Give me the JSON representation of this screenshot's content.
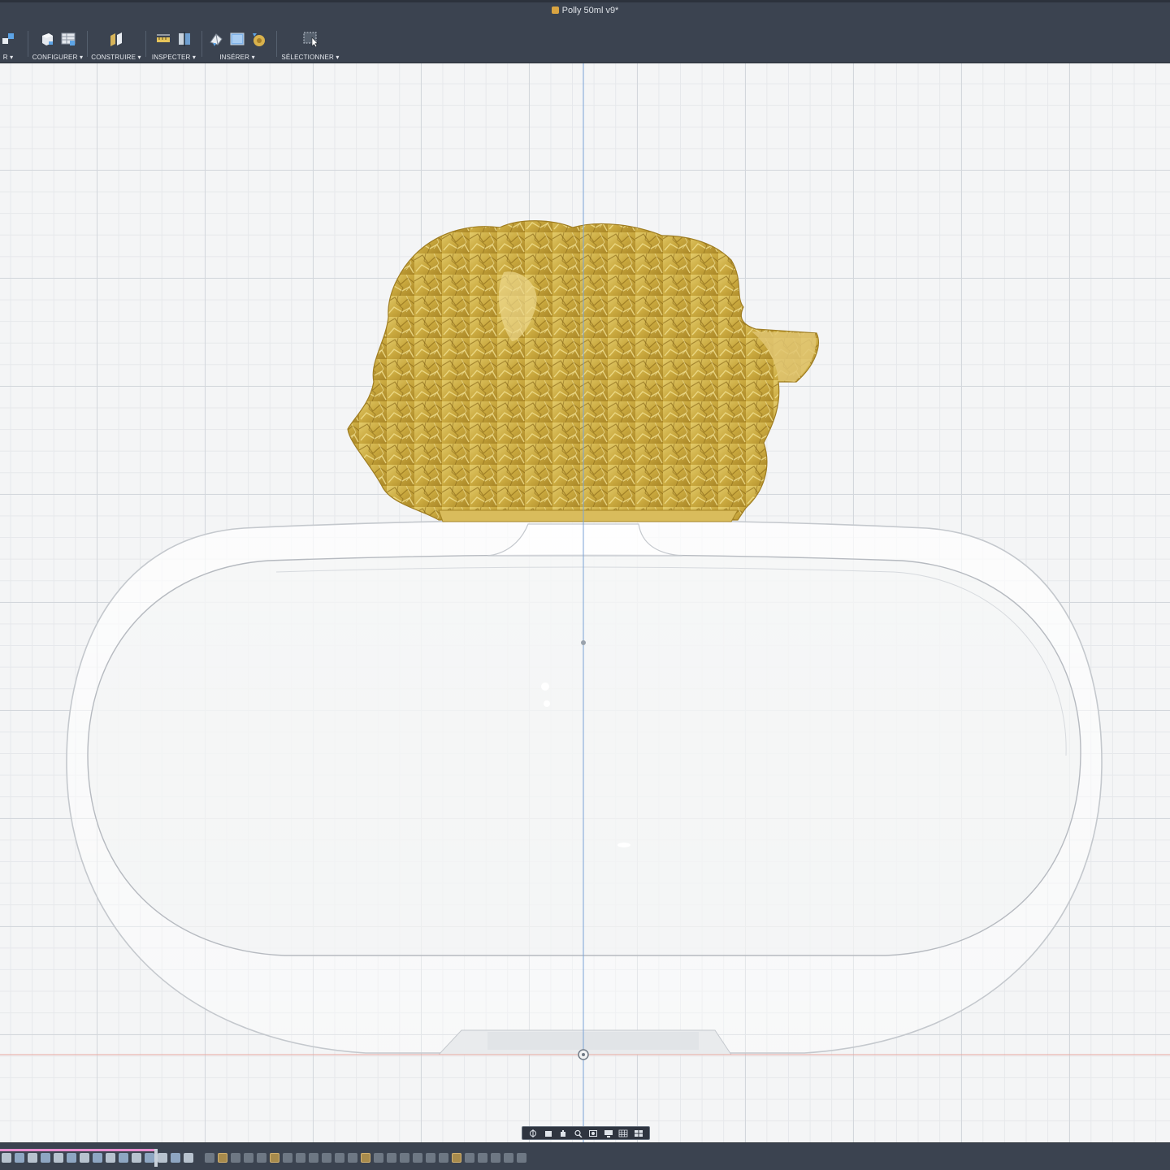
{
  "window": {
    "title": "Polly 50ml v9*"
  },
  "toolbar": {
    "groups": [
      {
        "label": "R ▾",
        "icons": [
          "create-sketch-icon"
        ]
      },
      {
        "label": "CONFIGURER ▾",
        "icons": [
          "box-icon",
          "table-parameters-icon"
        ]
      },
      {
        "label": "CONSTRUIRE ▾",
        "icons": [
          "offset-plane-icon"
        ]
      },
      {
        "label": "INSPECTER ▾",
        "icons": [
          "measure-icon",
          "section-analysis-icon"
        ]
      },
      {
        "label": "INSÉRER ▾",
        "icons": [
          "insert-mesh-icon",
          "decal-icon",
          "insert-mcmaster-icon"
        ]
      },
      {
        "label": "SÉLECTIONNER ▾",
        "icons": [
          "select-window-icon"
        ]
      }
    ]
  },
  "viewport": {
    "model": {
      "cap": {
        "material": "gold",
        "color": "#c9a83e"
      },
      "bottle": {
        "material": "glass",
        "color": "#ffffff"
      }
    },
    "grid": true
  },
  "navigation_bar": {
    "tools": [
      "orbit-icon",
      "look-at-icon",
      "pan-icon",
      "zoom-icon",
      "fit-icon",
      "display-settings-icon",
      "grid-settings-icon",
      "viewports-icon"
    ]
  },
  "timeline": {
    "item_count": 44
  }
}
